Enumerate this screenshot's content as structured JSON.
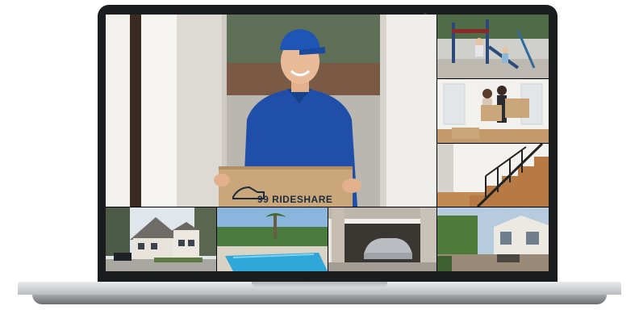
{
  "screen": {
    "box_label": "99 RIDESHARE"
  },
  "tiles": [
    {
      "id": "main",
      "icon": "delivery-person-photo"
    },
    {
      "id": "play",
      "icon": "playground-photo"
    },
    {
      "id": "moving",
      "icon": "moving-couple-photo"
    },
    {
      "id": "stairs",
      "icon": "staircase-photo"
    },
    {
      "id": "house",
      "icon": "house-exterior-photo"
    },
    {
      "id": "pool",
      "icon": "pool-photo"
    },
    {
      "id": "garage",
      "icon": "garage-photo"
    },
    {
      "id": "patio",
      "icon": "patio-photo"
    }
  ],
  "colors": {
    "lid": "#1b1c1e",
    "base": "#c9cbce",
    "uniform": "#1f4fa8",
    "cardboard": "#c9a77a"
  }
}
